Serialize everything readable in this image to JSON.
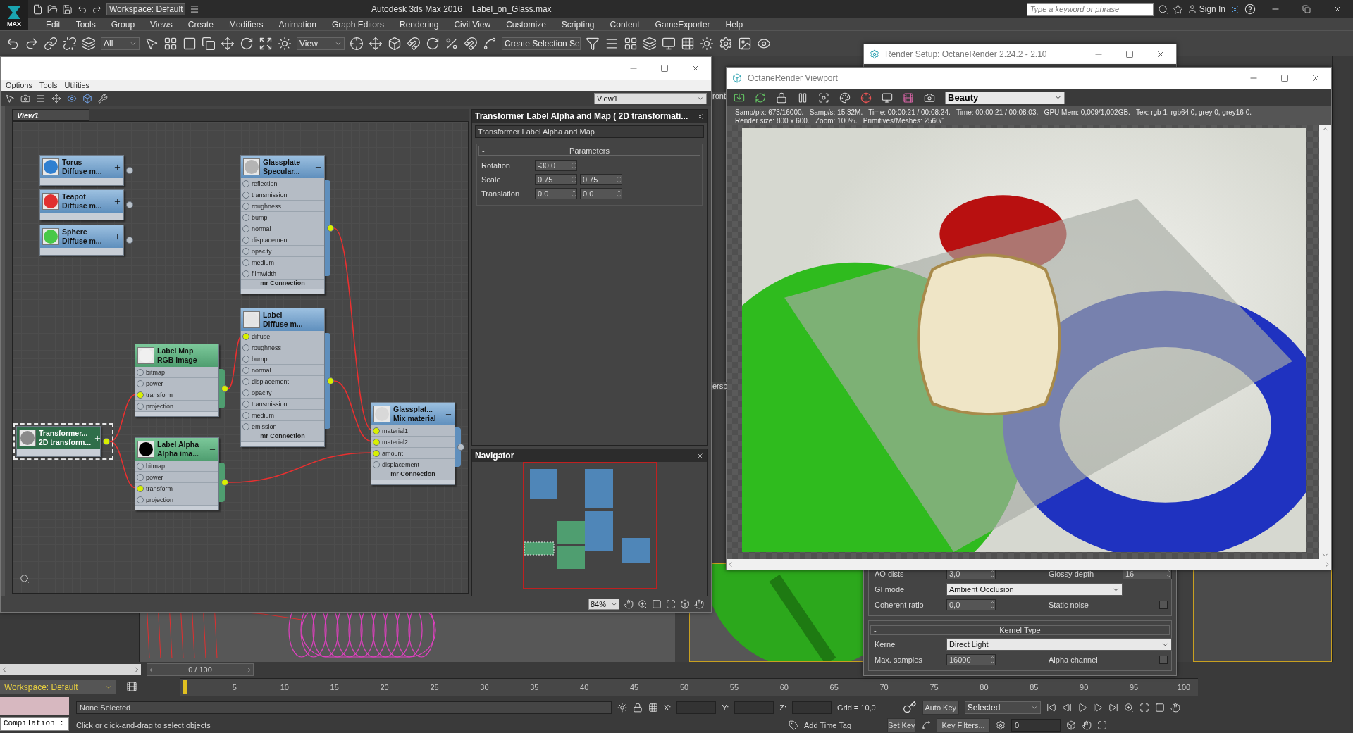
{
  "app": {
    "logo": "MAX",
    "workspace": "Workspace: Default",
    "name": "Autodesk 3ds Max 2016",
    "file": "Label_on_Glass.max",
    "search": {
      "placeholder": "Type a keyword or phrase"
    },
    "sign_in": "Sign In"
  },
  "menu": [
    "Edit",
    "Tools",
    "Group",
    "Views",
    "Create",
    "Modifiers",
    "Animation",
    "Graph Editors",
    "Rendering",
    "Civil View",
    "Customize",
    "Scripting",
    "Content",
    "GameExporter",
    "Help"
  ],
  "main_toolbar": {
    "selection_filter": "All",
    "reference_coordinates": "View",
    "named_selection": "Create Selection Se"
  },
  "viewport_labels": [
    "ront",
    "ersp"
  ],
  "slate": {
    "menu": [
      "Options",
      "Tools",
      "Utilities"
    ],
    "view_select": "View1",
    "tabs": [
      {
        "label": "View1",
        "selected": true
      }
    ],
    "nodes": [
      {
        "kind": "material",
        "title": "Torus",
        "subtitle": "Diffuse m...",
        "color": "#2f7fd0",
        "expanded": false,
        "selected": false,
        "output_connected": false
      },
      {
        "kind": "material",
        "title": "Teapot",
        "subtitle": "Diffuse m...",
        "color": "#e03030",
        "expanded": false,
        "selected": false,
        "output_connected": false
      },
      {
        "kind": "material",
        "title": "Sphere",
        "subtitle": "Diffuse m...",
        "color": "#48c848",
        "expanded": false,
        "selected": false,
        "output_connected": false
      },
      {
        "kind": "material",
        "title": "Glassplate",
        "subtitle": "Specular...",
        "color": "#b4b4b4",
        "expanded": true,
        "selected": false,
        "output_connected": true,
        "footer": "mr Connection",
        "ports": [
          {
            "label": "reflection",
            "connected": false
          },
          {
            "label": "transmission",
            "connected": false
          },
          {
            "label": "roughness",
            "connected": false
          },
          {
            "label": "bump",
            "connected": false
          },
          {
            "label": "normal",
            "connected": false
          },
          {
            "label": "displacement",
            "connected": false
          },
          {
            "label": "opacity",
            "connected": false
          },
          {
            "label": "medium",
            "connected": false
          },
          {
            "label": "filmwidth",
            "connected": false
          }
        ]
      },
      {
        "kind": "material",
        "title": "Label",
        "subtitle": "Diffuse m...",
        "color": "#e4e4e4",
        "expanded": true,
        "selected": false,
        "output_connected": true,
        "footer": "mr Connection",
        "ports": [
          {
            "label": "diffuse",
            "connected": true
          },
          {
            "label": "roughness",
            "connected": false
          },
          {
            "label": "bump",
            "connected": false
          },
          {
            "label": "normal",
            "connected": false
          },
          {
            "label": "displacement",
            "connected": false
          },
          {
            "label": "opacity",
            "connected": false
          },
          {
            "label": "transmission",
            "connected": false
          },
          {
            "label": "medium",
            "connected": false
          },
          {
            "label": "emission",
            "connected": false
          }
        ]
      },
      {
        "kind": "map",
        "title": "Label Map",
        "subtitle": "RGB image",
        "color": "#f0f0f0",
        "expanded": true,
        "selected": false,
        "output_connected": true,
        "ports": [
          {
            "label": "bitmap",
            "connected": false
          },
          {
            "label": "power",
            "connected": false
          },
          {
            "label": "transform",
            "connected": true
          },
          {
            "label": "projection",
            "connected": false
          }
        ]
      },
      {
        "kind": "map",
        "title": "Transformer...",
        "subtitle": "2D transform...",
        "color": "#8a8a8a",
        "expanded": false,
        "selected": true,
        "output_connected": true
      },
      {
        "kind": "map",
        "title": "Label Alpha",
        "subtitle": "Alpha  ima...",
        "color": "#000000",
        "expanded": true,
        "selected": false,
        "output_connected": true,
        "ports": [
          {
            "label": "bitmap",
            "connected": false
          },
          {
            "label": "power",
            "connected": false
          },
          {
            "label": "transform",
            "connected": true
          },
          {
            "label": "projection",
            "connected": false
          }
        ]
      },
      {
        "kind": "material",
        "title": "Glassplat...",
        "subtitle": "Mix material",
        "color": "#d8d8d8",
        "expanded": true,
        "selected": false,
        "output_connected": false,
        "footer": "mr Connection",
        "ports": [
          {
            "label": "material1",
            "connected": true
          },
          {
            "label": "material2",
            "connected": true
          },
          {
            "label": "amount",
            "connected": true
          },
          {
            "label": "displacement",
            "connected": false
          }
        ]
      }
    ],
    "params": {
      "title": "Transformer Label Alpha and Map  ( 2D transformati...",
      "name": "Transformer Label Alpha and Map",
      "rollout": {
        "toggle": "-",
        "label": "Parameters"
      },
      "rows": [
        {
          "label": "Rotation",
          "values": [
            "-30,0"
          ]
        },
        {
          "label": "Scale",
          "values": [
            "0,75",
            "0,75"
          ]
        },
        {
          "label": "Translation",
          "values": [
            "0,0",
            "0,0"
          ]
        }
      ]
    },
    "navigator": {
      "title": "Navigator"
    },
    "zoom": "84%"
  },
  "octane": {
    "title": "OctaneRender Viewport",
    "pass": "Beauty",
    "status": [
      "Samp/pix: 673/16000.   Samp/s: 15,32M.   Time: 00:00:21 / 00:08:24.   Time: 00:00:21 / 00:08:03.   GPU Mem: 0,009/1,002GB.   Tex: rgb 1, rgb64 0, grey 0, grey16 0.",
      "Render size: 800 x 600.   Zoom: 100%.   Primitives/Meshes: 2560/1"
    ]
  },
  "render_setup": {
    "title": "Render Setup: OctaneRender 2.24.2 - 2.10",
    "sections": [
      {
        "rows": [
          [
            {
              "kind": "spinner",
              "label": "AO dists",
              "value": "3,0"
            },
            {
              "kind": "spinner",
              "label": "Glossy depth",
              "value": "16"
            }
          ],
          [
            {
              "kind": "dropdown",
              "label": "GI mode",
              "value": "Ambient Occlusion"
            }
          ],
          [
            {
              "kind": "spinner",
              "label": "Coherent ratio",
              "value": "0,0"
            },
            {
              "kind": "checkbox",
              "label": "Static noise",
              "checked": false
            }
          ]
        ]
      },
      {
        "toggle": "-",
        "header": "Kernel Type",
        "rows": [
          [
            {
              "kind": "dropdown",
              "label": "Kernel",
              "value": "Direct Light"
            }
          ],
          [
            {
              "kind": "spinner",
              "label": "Max. samples",
              "value": "16000"
            },
            {
              "kind": "checkbox",
              "label": "Alpha channel",
              "checked": false
            }
          ]
        ]
      }
    ]
  },
  "bottom": {
    "time_slider": "0 / 100",
    "workspace": "Workspace: Default",
    "ticks": [
      "5",
      "10",
      "15",
      "20",
      "25",
      "30",
      "35",
      "40",
      "45",
      "50",
      "55",
      "60",
      "65",
      "70",
      "75",
      "80",
      "85",
      "90",
      "95",
      "100"
    ],
    "compilation": "Compilation :",
    "selection_status": "None Selected",
    "prompt": "Click or click-and-drag to select objects",
    "coords": [
      "X:",
      "Y:",
      "Z:"
    ],
    "grid": "Grid = 10,0",
    "add_time_tag": "Add Time Tag",
    "auto_key": "Auto Key",
    "key_mode": "Selected",
    "set_key": "Set Key",
    "key_filters": "Key Filters...",
    "frame": "0"
  }
}
